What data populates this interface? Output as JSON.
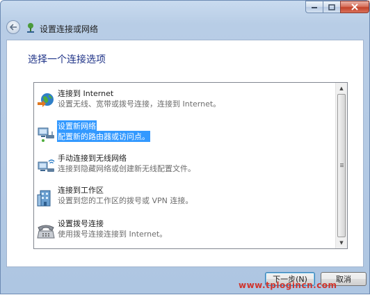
{
  "window": {
    "title": "设置连接或网络",
    "heading": "选择一个连接选项"
  },
  "options": [
    {
      "title": "连接到 Internet",
      "desc": "设置无线、宽带或拨号连接，连接到 Internet。",
      "icon": "globe-internet-icon",
      "selected": false
    },
    {
      "title": "设置新网络",
      "desc": "配置新的路由器或访问点。",
      "icon": "new-network-icon",
      "selected": true
    },
    {
      "title": "手动连接到无线网络",
      "desc": "连接到隐藏网络或创建新无线配置文件。",
      "icon": "wireless-network-icon",
      "selected": false
    },
    {
      "title": "连接到工作区",
      "desc": "设置到您的工作区的拨号或 VPN 连接。",
      "icon": "workplace-icon",
      "selected": false
    },
    {
      "title": "设置拨号连接",
      "desc": "使用拨号连接连接到 Internet。",
      "icon": "dialup-phone-icon",
      "selected": false
    }
  ],
  "buttons": {
    "next": "下一步(N)",
    "cancel": "取消"
  },
  "watermark": "www.tplogincn.com",
  "colors": {
    "selection": "#3399ff",
    "heading": "#1e3287",
    "watermark": "#d0342c"
  }
}
